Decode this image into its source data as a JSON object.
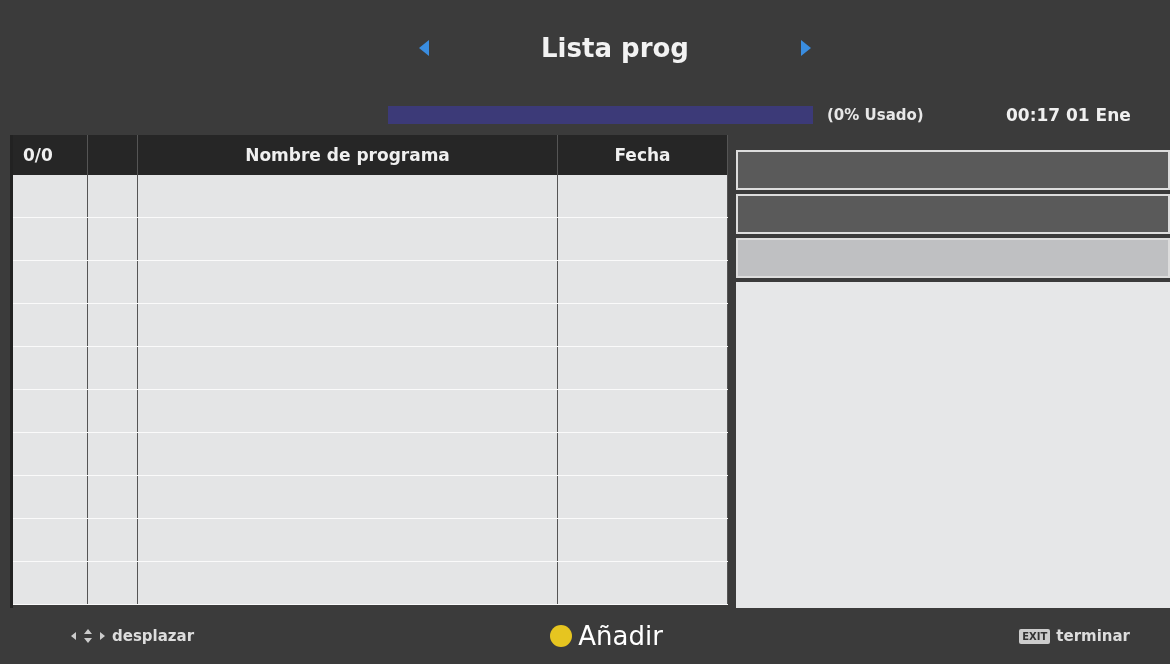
{
  "header": {
    "title": "Lista prog"
  },
  "storage": {
    "level": 0,
    "reading": "(0% Usado)"
  },
  "clock": "00:17 01 Ene",
  "table": {
    "columns": [
      "0/0",
      "",
      "Nombre de programa",
      "Fecha"
    ]
  },
  "footer": [
    {
      "kind": "scroll",
      "label": "desplazar"
    },
    {
      "kind": "yellow",
      "label": "Añadir"
    },
    {
      "kind": "exit",
      "key": "EXIT",
      "label": "terminar"
    }
  ]
}
